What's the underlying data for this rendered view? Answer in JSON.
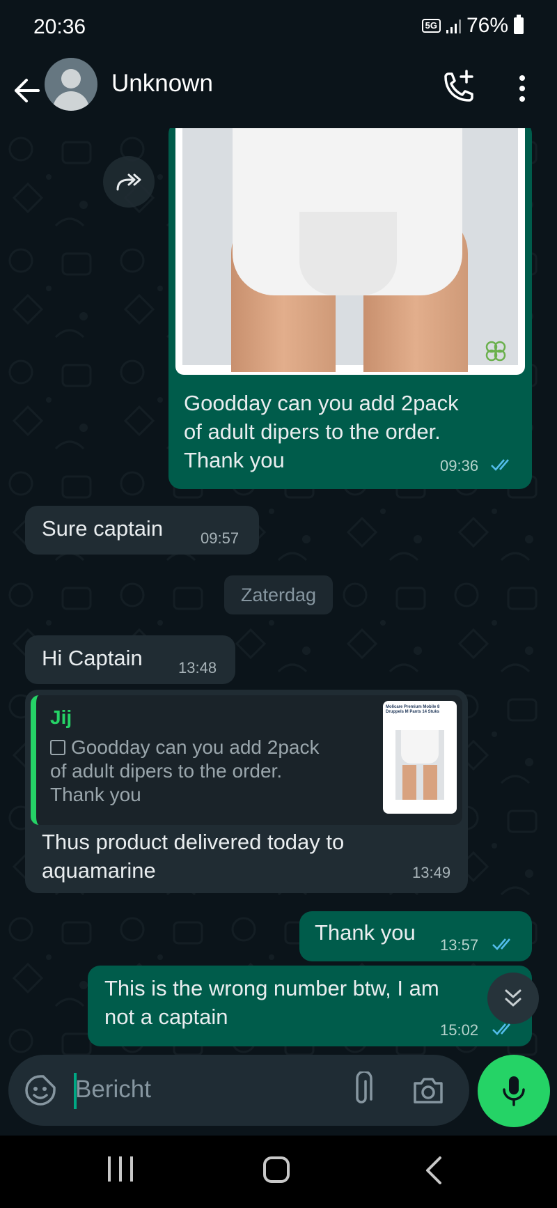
{
  "status_bar": {
    "time": "20:36",
    "network": "5G",
    "battery": "76%"
  },
  "header": {
    "contact_name": "Unknown",
    "icons": [
      "back-arrow-icon",
      "avatar",
      "add-call-icon",
      "more-vertical-icon"
    ]
  },
  "messages": [
    {
      "direction": "outgoing",
      "has_image": true,
      "image_description_icon": "diaper-product-image",
      "text": "Goodday can you add 2pack of adult dipers to the order. Thank you",
      "text_lines": [
        "Goodday can you add 2pack",
        "of adult dipers to the order.",
        "Thank you"
      ],
      "time": "09:36",
      "read": true
    },
    {
      "direction": "incoming",
      "text": "Sure captain",
      "time": "09:57"
    },
    {
      "direction": "incoming",
      "text": "Hi Captain",
      "time": "13:48"
    },
    {
      "direction": "incoming",
      "quote": {
        "author": "Jij",
        "text_lines": [
          "Goodday can you add 2pack",
          "of adult dipers to the order.",
          "Thank you"
        ],
        "thumb_title": "Molicare Premium Mobile 8 Druppels M Pants 14 Stuks"
      },
      "text_lines": [
        "Thus product delivered today to",
        "aquamarine"
      ],
      "time": "13:49"
    },
    {
      "direction": "outgoing",
      "text": "Thank you",
      "time": "13:57",
      "read": true
    },
    {
      "direction": "outgoing",
      "text_lines": [
        "This is the wrong number btw, I am",
        "not a captain"
      ],
      "time": "15:02",
      "read": true
    }
  ],
  "date_separator": "Zaterdag",
  "input": {
    "placeholder": "Bericht"
  },
  "colors": {
    "background": "#0b141a",
    "outgoing_bubble": "#005c4b",
    "incoming_bubble": "#202c33",
    "accent_green": "#25d366",
    "read_tick_blue": "#53bdeb"
  }
}
